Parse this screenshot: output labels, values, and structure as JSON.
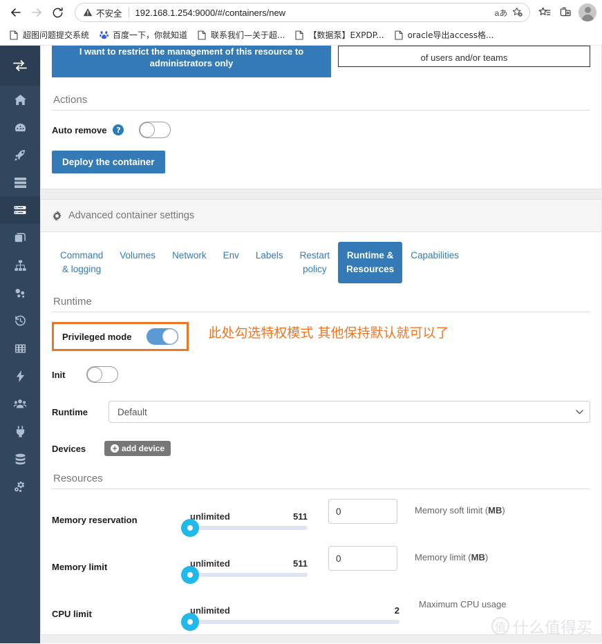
{
  "browser": {
    "back_icon": "back-arrow-icon",
    "forward_icon": "forward-arrow-icon",
    "reload_icon": "reload-icon",
    "security_warning": "不安全",
    "url": "192.168.1.254:9000/#/containers/new",
    "translate_label": "aあ",
    "omnibox_icons": [
      "translate-icon",
      "add-favorite-icon"
    ],
    "toolbar_icons": [
      "favorites-icon",
      "collections-icon",
      "profile-avatar"
    ],
    "bookmarks": [
      {
        "label": "超图问题提交系统",
        "icon": "page-icon"
      },
      {
        "label": "百度一下，你就知道",
        "icon": "baidu-icon"
      },
      {
        "label": "联系我们—关于超...",
        "icon": "page-icon"
      },
      {
        "label": "【数据泵】EXPDP...",
        "icon": "page-icon"
      },
      {
        "label": "oracle导出access格...",
        "icon": "page-icon"
      }
    ]
  },
  "sidebar": {
    "toggle_icon": "collapse-sidebar-icon",
    "items": [
      {
        "name": "home",
        "icon": "home-icon",
        "active": false
      },
      {
        "name": "dashboard",
        "icon": "dashboard-icon",
        "active": false
      },
      {
        "name": "app-templates",
        "icon": "rocket-icon",
        "active": false
      },
      {
        "name": "stacks",
        "icon": "list-icon",
        "active": false
      },
      {
        "name": "containers",
        "icon": "server-icon",
        "active": true
      },
      {
        "name": "images",
        "icon": "images-icon",
        "active": false
      },
      {
        "name": "networks",
        "icon": "sitemap-icon",
        "active": false
      },
      {
        "name": "volumes",
        "icon": "volumes-icon",
        "active": false
      },
      {
        "name": "events",
        "icon": "history-icon",
        "active": false
      },
      {
        "name": "host",
        "icon": "grid-icon",
        "active": false
      },
      {
        "name": "quick-actions",
        "icon": "bolt-icon",
        "active": false
      },
      {
        "name": "users",
        "icon": "users-icon",
        "active": false
      },
      {
        "name": "endpoints",
        "icon": "plug-icon",
        "active": false
      },
      {
        "name": "registries",
        "icon": "database-icon",
        "active": false
      },
      {
        "name": "settings",
        "icon": "cogs-icon",
        "active": false
      }
    ]
  },
  "access_control": {
    "restrict_button": "I want to restrict the management of this resource to administrators only",
    "teams_box": "of users and/or teams"
  },
  "actions": {
    "title": "Actions",
    "auto_remove_label": "Auto remove",
    "auto_remove_help": "?",
    "auto_remove_on": false,
    "deploy_button": "Deploy the container"
  },
  "advanced": {
    "header": "Advanced container settings",
    "header_icon": "gear-icon",
    "tabs": [
      {
        "label": "Command\n& logging",
        "active": false
      },
      {
        "label": "Volumes",
        "active": false
      },
      {
        "label": "Network",
        "active": false
      },
      {
        "label": "Env",
        "active": false
      },
      {
        "label": "Labels",
        "active": false
      },
      {
        "label": "Restart\npolicy",
        "active": false
      },
      {
        "label": "Runtime &\nResources",
        "active": true
      },
      {
        "label": "Capabilities",
        "active": false
      }
    ]
  },
  "runtime": {
    "section_title": "Runtime",
    "privileged_label": "Privileged mode",
    "privileged_on": true,
    "annotation": "此处勾选特权模式 其他保持默认就可以了",
    "init_label": "Init",
    "init_on": false,
    "runtime_label": "Runtime",
    "runtime_value": "Default",
    "runtime_caret": "chevron-down-icon",
    "devices_label": "Devices",
    "add_device_button": "add device",
    "add_device_icon": "plus-circle-icon"
  },
  "resources": {
    "section_title": "Resources",
    "rows": [
      {
        "label": "Memory reservation",
        "min_label": "unlimited",
        "max_label": "511",
        "value": 0,
        "input_value": "0",
        "unit_text": "Memory soft limit (",
        "unit_bold": "MB",
        "unit_suffix": ")",
        "track_width": 170,
        "has_input": true
      },
      {
        "label": "Memory limit",
        "min_label": "unlimited",
        "max_label": "511",
        "value": 0,
        "input_value": "0",
        "unit_text": "Memory limit (",
        "unit_bold": "MB",
        "unit_suffix": ")",
        "track_width": 170,
        "has_input": true
      },
      {
        "label": "CPU limit",
        "min_label": "unlimited",
        "max_label": "2",
        "value": 0,
        "input_value": "",
        "unit_text": "Maximum CPU usage",
        "unit_bold": "",
        "unit_suffix": "",
        "track_width": 303,
        "has_input": false
      }
    ]
  },
  "watermark": {
    "mark": "值",
    "text": "什么值得买"
  },
  "colors": {
    "brand_blue": "#337ab7",
    "sidebar": "#32475e",
    "slider_blue": "#21b8ea",
    "annotation_orange": "#f07522",
    "toggle_on": "#5b9bd5"
  }
}
